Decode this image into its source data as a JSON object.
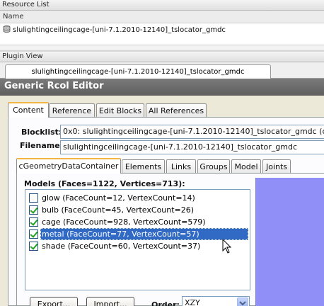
{
  "resource_list": {
    "title": "Resource List",
    "column_header": "Name",
    "rows": [
      {
        "name": "slulightingceilingcage-[uni-7.1.2010-12140]_tslocator_gmdc"
      }
    ]
  },
  "plugin_view": {
    "title": "Plugin View",
    "document_tab": "slulightingceilingcage-[uni-7.1.2010-12140]_tslocator_gmdc"
  },
  "editor": {
    "title": "Generic Rcol Editor",
    "tabs": [
      "Content",
      "Reference",
      "Edit Blocks",
      "All References"
    ],
    "blocklist_label": "Blocklist:",
    "blocklist_value": "0x0: slulightingceilingcage-[uni-7.1.2010-12140]_tslocator_gmdc (c",
    "filename_label": "Filename:",
    "filename_value": "slulightingceilingcage-[uni-7.1.2010-12140]_tslocator_gmdc",
    "inner_tabs": [
      "cGeometryDataContainer",
      "Elements",
      "Links",
      "Groups",
      "Model",
      "Joints"
    ],
    "models_label": "Models (Faces=1122, Vertices=713):",
    "models": [
      {
        "label": "glow (FaceCount=12, VertexCount=14)",
        "checked": false,
        "selected": false
      },
      {
        "label": "bulb (FaceCount=45, VertexCount=26)",
        "checked": true,
        "selected": false
      },
      {
        "label": "cage (FaceCount=928, VertexCount=579)",
        "checked": true,
        "selected": false
      },
      {
        "label": "metal (FaceCount=77, VertexCount=57)",
        "checked": true,
        "selected": true
      },
      {
        "label": "shade (FaceCount=60, VertexCount=37)",
        "checked": true,
        "selected": false
      }
    ],
    "export_label": "Export...",
    "import_label": "Import...",
    "order_label": "Order:",
    "order_value": "XZY",
    "preview_color": "#8f8ff7",
    "selection_color": "#316ac5",
    "title_bar_color": "#6b6b6b"
  }
}
